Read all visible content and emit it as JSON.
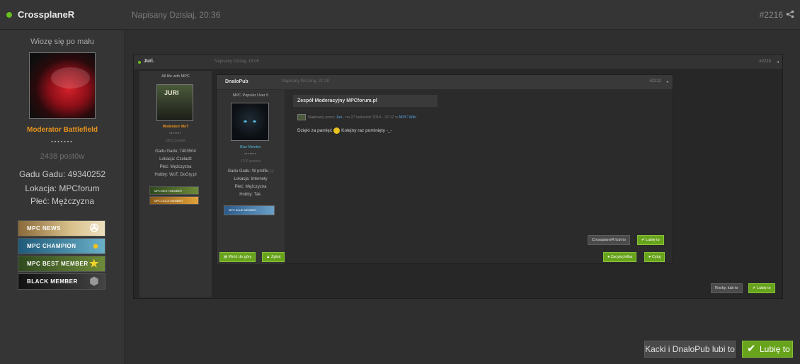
{
  "post": {
    "author": "CrossplaneR",
    "posted": "Napisany Dzisiaj, 20:36",
    "number": "#2216"
  },
  "sidebar": {
    "title": "Wiozę się po mału",
    "rank": "Moderator Battlefield",
    "stars": "▪▪▪▪▪▪▪",
    "posts": "2438 postów",
    "gadu": "Gadu Gadu: 49340252",
    "location": "Lokacja: MPCforum",
    "gender": "Płeć: Mężczyzna",
    "badges": [
      {
        "label": "MPC NEWS",
        "icon": "satellite-icon",
        "color_from": "#8a6a3a",
        "color_to": "#d8c08a"
      },
      {
        "label": "MPC CHAMPION",
        "icon": "medal-icon",
        "color_from": "#1f5a7a",
        "color_to": "#6ab0c8"
      },
      {
        "label": "MPC BEST MEMBER",
        "icon": "star-icon",
        "color_from": "#2f4a1e",
        "color_to": "#6e8a3a"
      },
      {
        "label": "BLACK MEMBER",
        "icon": "shield-icon",
        "color_from": "#111111",
        "color_to": "#444444"
      }
    ]
  },
  "screenshot": {
    "post": {
      "author": "Juri.",
      "posted": "Napisany Dzisiaj, 18:06",
      "number": "#2213"
    },
    "sidebar": {
      "title": "All life with MPC",
      "rank": "Moderator WoT",
      "stars": "▪▪▪▪▪▪▪",
      "posts": "5505 postów",
      "gadu": "Gadu Gadu: 7403504",
      "location": "Lokacja: Czeladź",
      "gender": "Płeć: Mężczyzna",
      "hobby": "Hobby: WoT, DoGry.pl",
      "badges": [
        "MPC BEST MEMBER",
        "MPC GOLD MEMBER"
      ]
    },
    "quote": {
      "author": "DnaloPub",
      "posted": "Napisany Wczoraj, 21:28",
      "number": "#2212",
      "sidebar": {
        "title": "MPC Popular User II",
        "rank": "Blue Member",
        "stars": "▪▪▪▪▪▪▪",
        "posts": "1706 postów",
        "gadu": "Gadu Gadu: W profilu ;-;",
        "location": "Lokacja: Internety",
        "gender": "Płeć: Mężczyzna",
        "hobby": "Hobby: Tak.",
        "badge": "MPC BLUE MEMBER"
      },
      "topic": "Zespół Moderacyjny MPCforum.pl",
      "meta_prefix": "Napisany przez",
      "meta_author": "Juri.",
      "meta_mid": "na 27 kwiecień 2014 - 22:12 w",
      "meta_forum": "MPC Wiki",
      "message_before": "Dzięki za pamięć",
      "message_after": "Kolejny raz pominięty -_-",
      "likes": "CrossplaneR lubi to",
      "like": "Lubię to"
    },
    "footer": {
      "back_to_top": "Wróć do góry",
      "report": "Zgłoś",
      "multiquote": "Zacytuj kilka",
      "quote": "Cytuj"
    },
    "likes": "Rocky. lubi to",
    "like": "Lubię to"
  },
  "actions": {
    "likes": "Kacki i DnaloPub lubi to",
    "like": "Lubię to"
  },
  "colors": {
    "accent_green": "#67a31b",
    "rank_orange": "#e8931c",
    "online": "#6abf1e",
    "link_blue": "#5aa3df"
  }
}
